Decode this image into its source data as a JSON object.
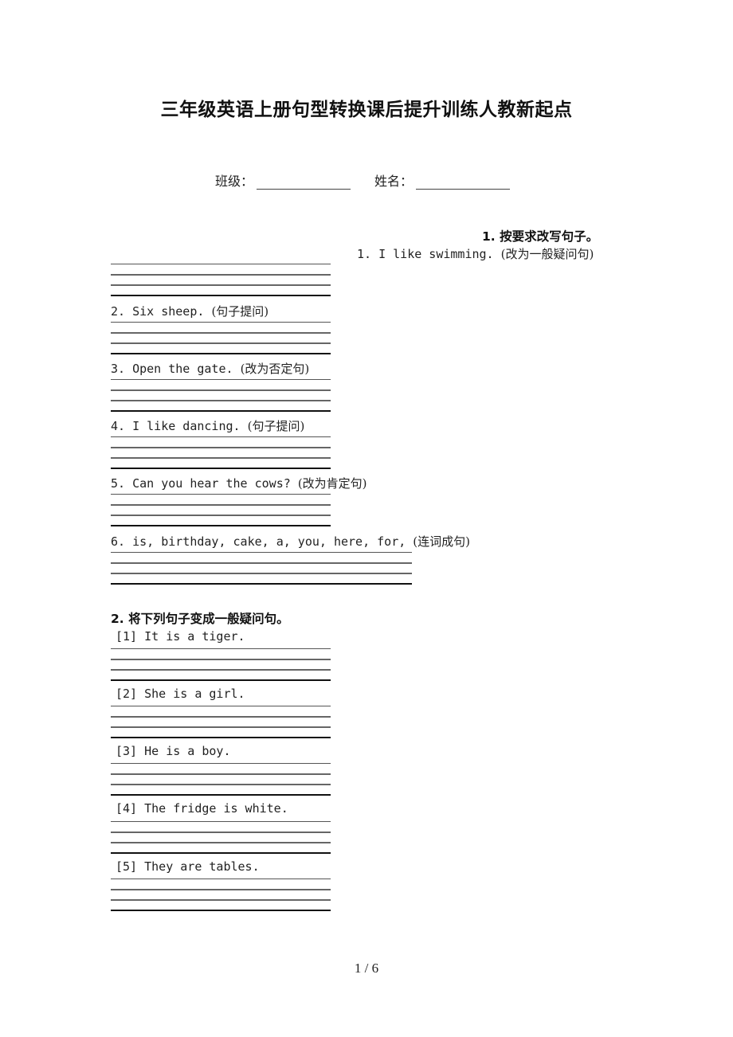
{
  "document": {
    "title": "三年级英语上册句型转换课后提升训练人教新起点",
    "class_label": "班级：",
    "name_label": "姓名：",
    "page_number": "1 / 6"
  },
  "section1": {
    "heading": "1. 按要求改写句子。",
    "questions": [
      {
        "text": "1. I like swimming.",
        "instruction": "(改为一般疑问句)"
      },
      {
        "text": "2. Six sheep.",
        "instruction": "(句子提问)"
      },
      {
        "text": "3. Open the gate.",
        "instruction": "(改为否定句)"
      },
      {
        "text": "4. I like dancing.",
        "instruction": "(句子提问)"
      },
      {
        "text": "5. Can you hear the cows?",
        "instruction": "(改为肯定句)"
      },
      {
        "text": "6. is, birthday, cake, a, you, here, for,",
        "instruction": "(连词成句)"
      }
    ]
  },
  "section2": {
    "heading": "2. 将下列句子变成一般疑问句。",
    "questions": [
      {
        "text": "[1] It is a tiger."
      },
      {
        "text": "[2] She is a girl."
      },
      {
        "text": "[3] He is a boy."
      },
      {
        "text": "[4] The fridge is white."
      },
      {
        "text": "[5] They are tables."
      }
    ]
  }
}
